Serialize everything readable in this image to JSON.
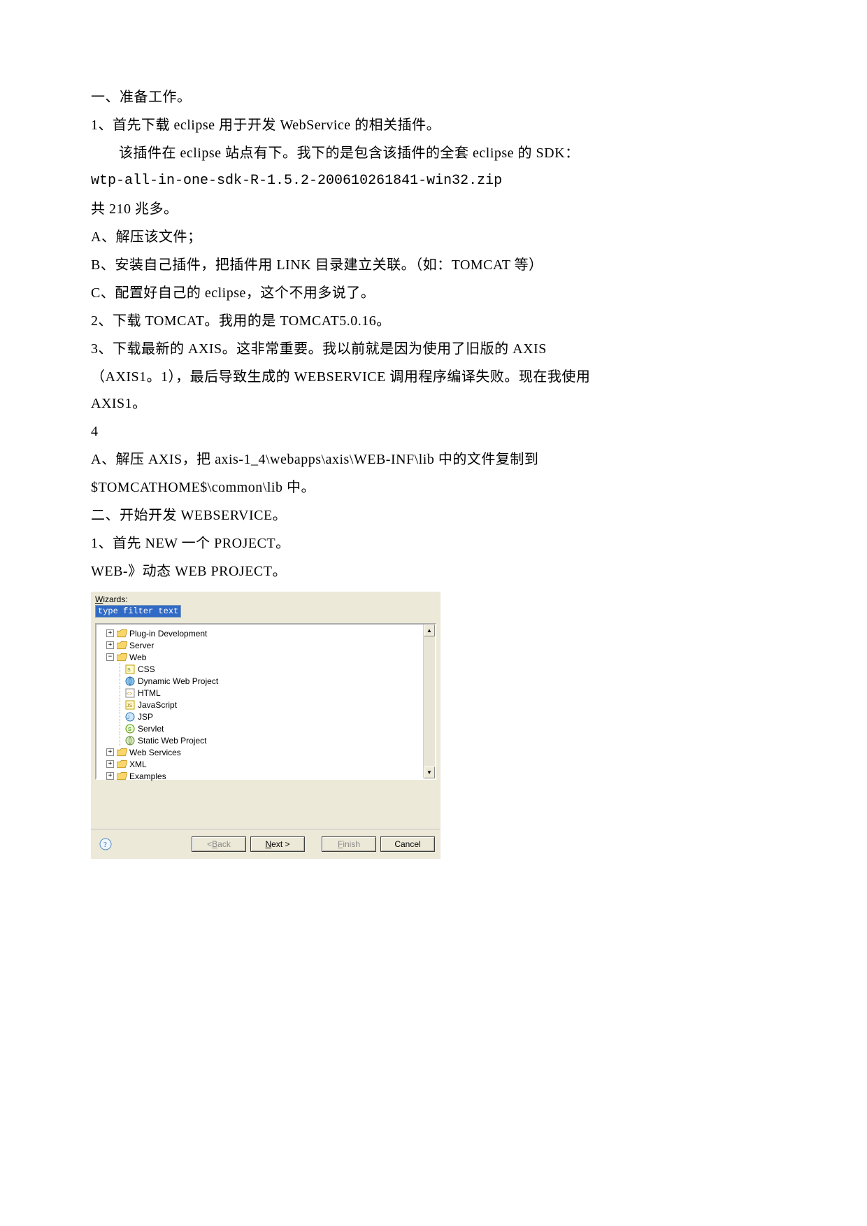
{
  "doc": {
    "p1": "一、准备工作。",
    "p2": "1、首先下载 eclipse 用于开发 WebService 的相关插件。",
    "p3": "该插件在 eclipse 站点有下。我下的是包含该插件的全套 eclipse 的 SDK：",
    "p4": "wtp-all-in-one-sdk-R-1.5.2-200610261841-win32.zip",
    "p5": "共 210 兆多。",
    "p6": "A、解压该文件；",
    "p7": "B、安装自己插件，把插件用 LINK 目录建立关联。（如：TOMCAT 等）",
    "p8": "C、配置好自己的 eclipse，这个不用多说了。",
    "p9": "2、下载 TOMCAT。我用的是 TOMCAT5.0.16。",
    "p10": "3、下载最新的 AXIS。这非常重要。我以前就是因为使用了旧版的 AXIS",
    "p11": "（AXIS1。1），最后导致生成的 WEBSERVICE 调用程序编译失败。现在我使用 AXIS1。",
    "p12": "4",
    "p13": "A、解压 AXIS，把 axis-1_4\\webapps\\axis\\WEB-INF\\lib 中的文件复制到",
    "p14": "$TOMCATHOME$\\common\\lib 中。",
    "p15": "二、开始开发 WEBSERVICE。",
    "p16": "1、首先 NEW 一个 PROJECT。",
    "p17": "WEB-》动态 WEB PROJECT。"
  },
  "wizard": {
    "label_pre": "W",
    "label_rest": "izards:",
    "filter_text": "type filter text",
    "tree": {
      "plug": "Plug-in Development",
      "server": "Server",
      "web": "Web",
      "css": "CSS",
      "dyn": "Dynamic Web Project",
      "html": "HTML",
      "js": "JavaScript",
      "jsp": "JSP",
      "servlet": "Servlet",
      "static": "Static Web Project",
      "ws": "Web Services",
      "xml": "XML",
      "ex": "Examples"
    },
    "buttons": {
      "back_pre": "< ",
      "back_u": "B",
      "back_rest": "ack",
      "next_u": "N",
      "next_rest": "ext >",
      "finish_u": "F",
      "finish_rest": "inish",
      "cancel": "Cancel"
    }
  }
}
